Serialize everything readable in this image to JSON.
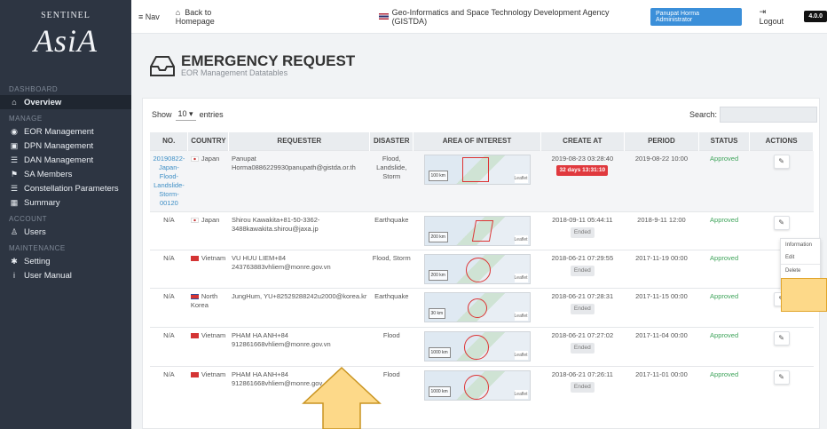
{
  "sidebar": {
    "brand_title": "SENTINEL",
    "brand_logo": "AsiA",
    "sections": [
      {
        "label": "DASHBOARD",
        "items": [
          {
            "label": "Overview",
            "icon": "home-icon",
            "glyph": "⌂",
            "active": true
          }
        ]
      },
      {
        "label": "MANAGE",
        "items": [
          {
            "label": "EOR Management",
            "icon": "target-icon",
            "glyph": "◉"
          },
          {
            "label": "DPN Management",
            "icon": "map-icon",
            "glyph": "▣"
          },
          {
            "label": "DAN Management",
            "icon": "list-icon",
            "glyph": "☰"
          },
          {
            "label": "SA Members",
            "icon": "flag-icon",
            "glyph": "⚑"
          },
          {
            "label": "Constellation Parameters",
            "icon": "list-icon",
            "glyph": "☰"
          },
          {
            "label": "Summary",
            "icon": "calendar-icon",
            "glyph": "▦"
          }
        ]
      },
      {
        "label": "ACCOUNT",
        "items": [
          {
            "label": "Users",
            "icon": "users-icon",
            "glyph": "♙"
          }
        ]
      },
      {
        "label": "MAINTENANCE",
        "items": [
          {
            "label": "Setting",
            "icon": "gear-icon",
            "glyph": "✱"
          },
          {
            "label": "User Manual",
            "icon": "info-icon",
            "glyph": "i"
          }
        ]
      }
    ]
  },
  "topbar": {
    "nav_label": "Nav",
    "home_label": "Back to Homepage",
    "agency": "Geo-Informatics and Space Technology Development Agency (GISTDA)",
    "user_name": "Panupat Horma",
    "user_role": "Administrator",
    "logout_label": "Logout",
    "version": "4.0.0"
  },
  "page": {
    "title": "EMERGENCY REQUEST",
    "subtitle": "EOR Management Datatables",
    "show_label": "Show",
    "show_value": "10",
    "entries_label": "entries",
    "search_label": "Search:"
  },
  "table": {
    "headers": [
      "NO.",
      "COUNTRY",
      "REQUESTER",
      "DISASTER",
      "AREA OF INTEREST",
      "CREATE AT",
      "PERIOD",
      "STATUS",
      "ACTIONS"
    ],
    "rows": [
      {
        "no": "20190822-Japan-Flood-Landslide-Storm-00120",
        "flag": "jp",
        "country": "Japan",
        "requester": "Panupat Horma0886229930panupath@gistda.or.th",
        "disaster": "Flood, Landslide, Storm",
        "scale": "100 km",
        "create_at": "2019-08-23 03:28:40",
        "badge": "32 days 13:31:10",
        "badge_type": "red",
        "period": "2019-08-22 10:00",
        "status": "Approved"
      },
      {
        "no": "N/A",
        "flag": "jp",
        "country": "Japan",
        "requester": "Shirou Kawakita+81-50-3362-3488kawakita.shirou@jaxa.jp",
        "disaster": "Earthquake",
        "scale": "200 km",
        "create_at": "2018-09-11 05:44:11",
        "badge": "Ended",
        "badge_type": "grey",
        "period": "2018-9-11 12:00",
        "status": "Approved"
      },
      {
        "no": "N/A",
        "flag": "vn",
        "country": "Vietnam",
        "requester": "VU HUU LIEM+84 243763883vhliem@monre.gov.vn",
        "disaster": "Flood, Storm",
        "scale": "200 km",
        "create_at": "2018-06-21 07:29:55",
        "badge": "Ended",
        "badge_type": "grey",
        "period": "2017-11-19 00:00",
        "status": "Approved"
      },
      {
        "no": "N/A",
        "flag": "kp",
        "country": "North Korea",
        "requester": "JungHum, YU+82529288242u2000@korea.kr",
        "disaster": "Earthquake",
        "scale": "30 km",
        "create_at": "2018-06-21 07:28:31",
        "badge": "Ended",
        "badge_type": "grey",
        "period": "2017-11-15 00:00",
        "status": "Approved"
      },
      {
        "no": "N/A",
        "flag": "vn",
        "country": "Vietnam",
        "requester": "PHAM HA ANH+84 912861668vhliem@monre.gov.vn",
        "disaster": "Flood",
        "scale": "1000 km",
        "create_at": "2018-06-21 07:27:02",
        "badge": "Ended",
        "badge_type": "grey",
        "period": "2017-11-04 00:00",
        "status": "Approved"
      },
      {
        "no": "N/A",
        "flag": "vn",
        "country": "Vietnam",
        "requester": "PHAM HA ANH+84 912861668vhliem@monre.gov",
        "disaster": "Flood",
        "scale": "1000 km",
        "create_at": "2018-06-21 07:26:11",
        "badge": "Ended",
        "badge_type": "grey",
        "period": "2017-11-01 00:00",
        "status": "Approved"
      }
    ]
  },
  "dropdown": {
    "items": [
      "Information",
      "Edit",
      "Delete"
    ]
  },
  "map_attribution": "Leaflet"
}
